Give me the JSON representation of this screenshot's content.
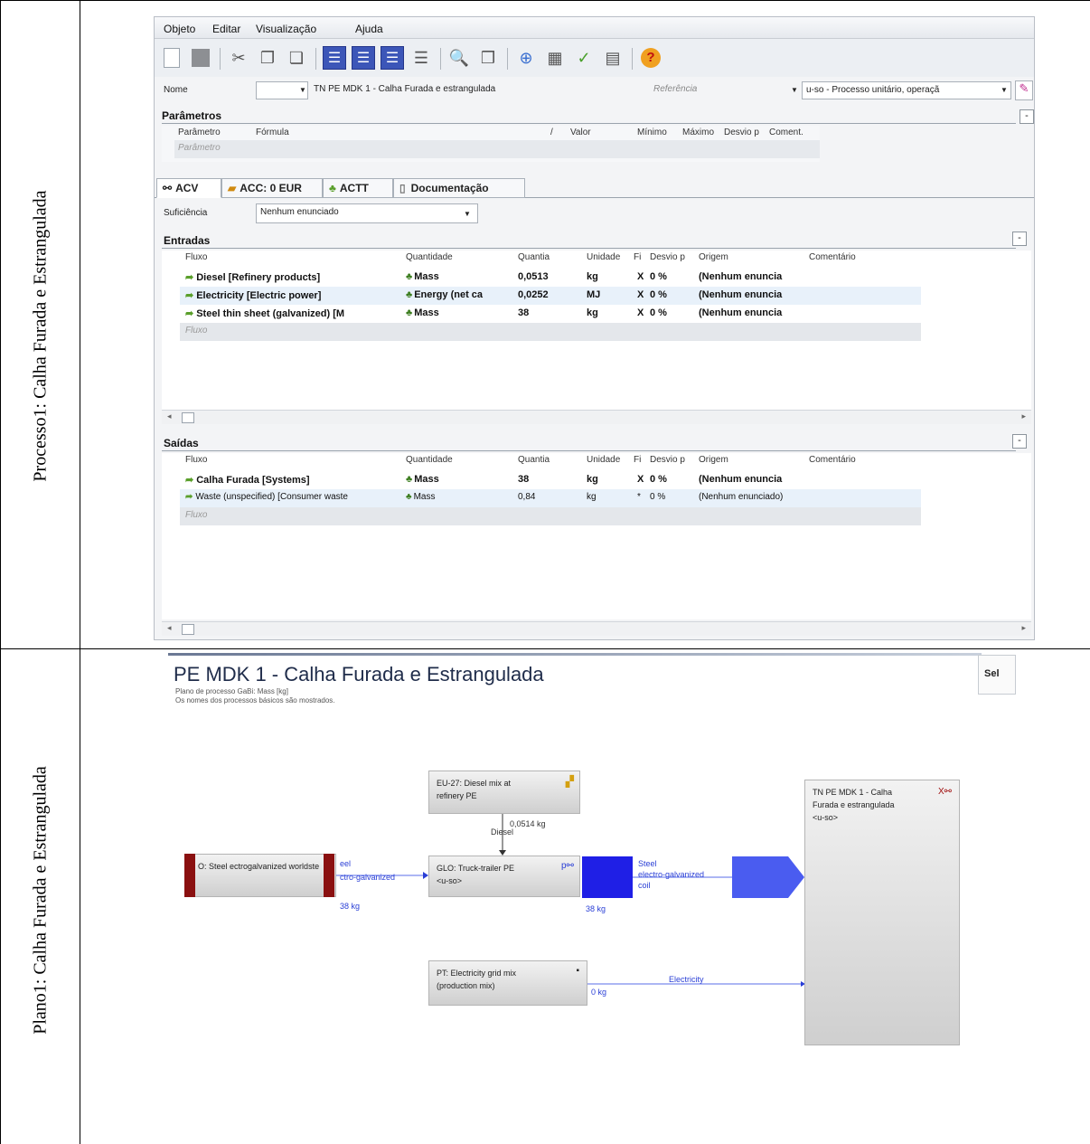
{
  "rows": {
    "row1_label": "Processo1: Calha Furada e Estrangulada",
    "row2_label": "Plano1: Calha Furada e Estrangulada"
  },
  "app": {
    "menu": [
      "Objeto",
      "Editar",
      "Visualização",
      "Ajuda"
    ],
    "name_label": "Nome",
    "name_value": "TN PE MDK 1 - Calha Furada e estrangulada",
    "reference_placeholder": "Referência",
    "process_type": "u-so - Processo unitário, operaçã",
    "parameters": {
      "title": "Parâmetros",
      "columns": [
        "Parâmetro",
        "Fórmula",
        "/",
        "Valor",
        "Mínimo",
        "Máximo",
        "Desvio p",
        "Coment."
      ],
      "placeholder": "Parâmetro"
    },
    "tabs": [
      "ACV",
      "ACC: 0 EUR",
      "ACTT",
      "Documentação"
    ],
    "sufficiency_label": "Suficiência",
    "sufficiency_value": "Nenhum enunciado",
    "inputs": {
      "title": "Entradas",
      "columns": [
        "Fluxo",
        "Quantidade",
        "Quantia",
        "Unidade",
        "Fi",
        "Desvio p",
        "Origem",
        "Comentário"
      ],
      "rows": [
        {
          "flow": "Diesel [Refinery products]",
          "quantity": "Mass",
          "amount": "0,0513",
          "unit": "kg",
          "fi": "X",
          "dev": "0 %",
          "origin": "(Nenhum enuncia",
          "bold": true
        },
        {
          "flow": "Electricity [Electric power]",
          "quantity": "Energy (net ca",
          "amount": "0,0252",
          "unit": "MJ",
          "fi": "X",
          "dev": "0 %",
          "origin": "(Nenhum enuncia",
          "bold": true
        },
        {
          "flow": "Steel thin sheet (galvanized) [M",
          "quantity": "Mass",
          "amount": "38",
          "unit": "kg",
          "fi": "X",
          "dev": "0 %",
          "origin": "(Nenhum enuncia",
          "bold": true
        }
      ],
      "placeholder": "Fluxo"
    },
    "outputs": {
      "title": "Saídas",
      "columns": [
        "Fluxo",
        "Quantidade",
        "Quantia",
        "Unidade",
        "Fi",
        "Desvio p",
        "Origem",
        "Comentário"
      ],
      "rows": [
        {
          "flow": "Calha Furada [Systems]",
          "quantity": "Mass",
          "amount": "38",
          "unit": "kg",
          "fi": "X",
          "dev": "0 %",
          "origin": "(Nenhum enuncia",
          "bold": true
        },
        {
          "flow": "Waste (unspecified) [Consumer waste",
          "quantity": "Mass",
          "amount": "0,84",
          "unit": "kg",
          "fi": "*",
          "dev": "0 %",
          "origin": "(Nenhum enunciado)",
          "bold": false
        }
      ],
      "placeholder": "Fluxo"
    }
  },
  "plan": {
    "title": "PE MDK 1 - Calha Furada e Estrangulada",
    "subtitle1": "Plano de processo GaBi: Mass [kg]",
    "subtitle2": "Os nomes dos processos básicos são mostrados.",
    "select_button": "Sel",
    "boxes": {
      "diesel": "EU-27: Diesel mix at refinery PE",
      "steel": "O: Steel ectrogalvanized worldste",
      "truck_l1": "GLO: Truck-trailer PE",
      "truck_l2": "<u-so>",
      "electricity": "PT: Electricity grid mix (production mix)",
      "main_l1": "TN PE MDK 1 - Calha",
      "main_l2": "Furada e estrangulada",
      "main_l3": "<u-so>"
    },
    "flows": {
      "diesel_name": "Diesel",
      "diesel_amt": "0,0514 kg",
      "steel_in1": "eel",
      "steel_in2": "ctro-galvanized",
      "steel_in_amt": "38 kg",
      "truck_amt": "38 kg",
      "steel_out1": "Steel",
      "steel_out2": "electro-galvanized",
      "steel_out3": "coil",
      "elec_amt": "0 kg",
      "elec_name": "Electricity"
    },
    "colors": {
      "flow_blue": "#1f1fe6",
      "arrow_blue": "#4a5cf0"
    }
  }
}
